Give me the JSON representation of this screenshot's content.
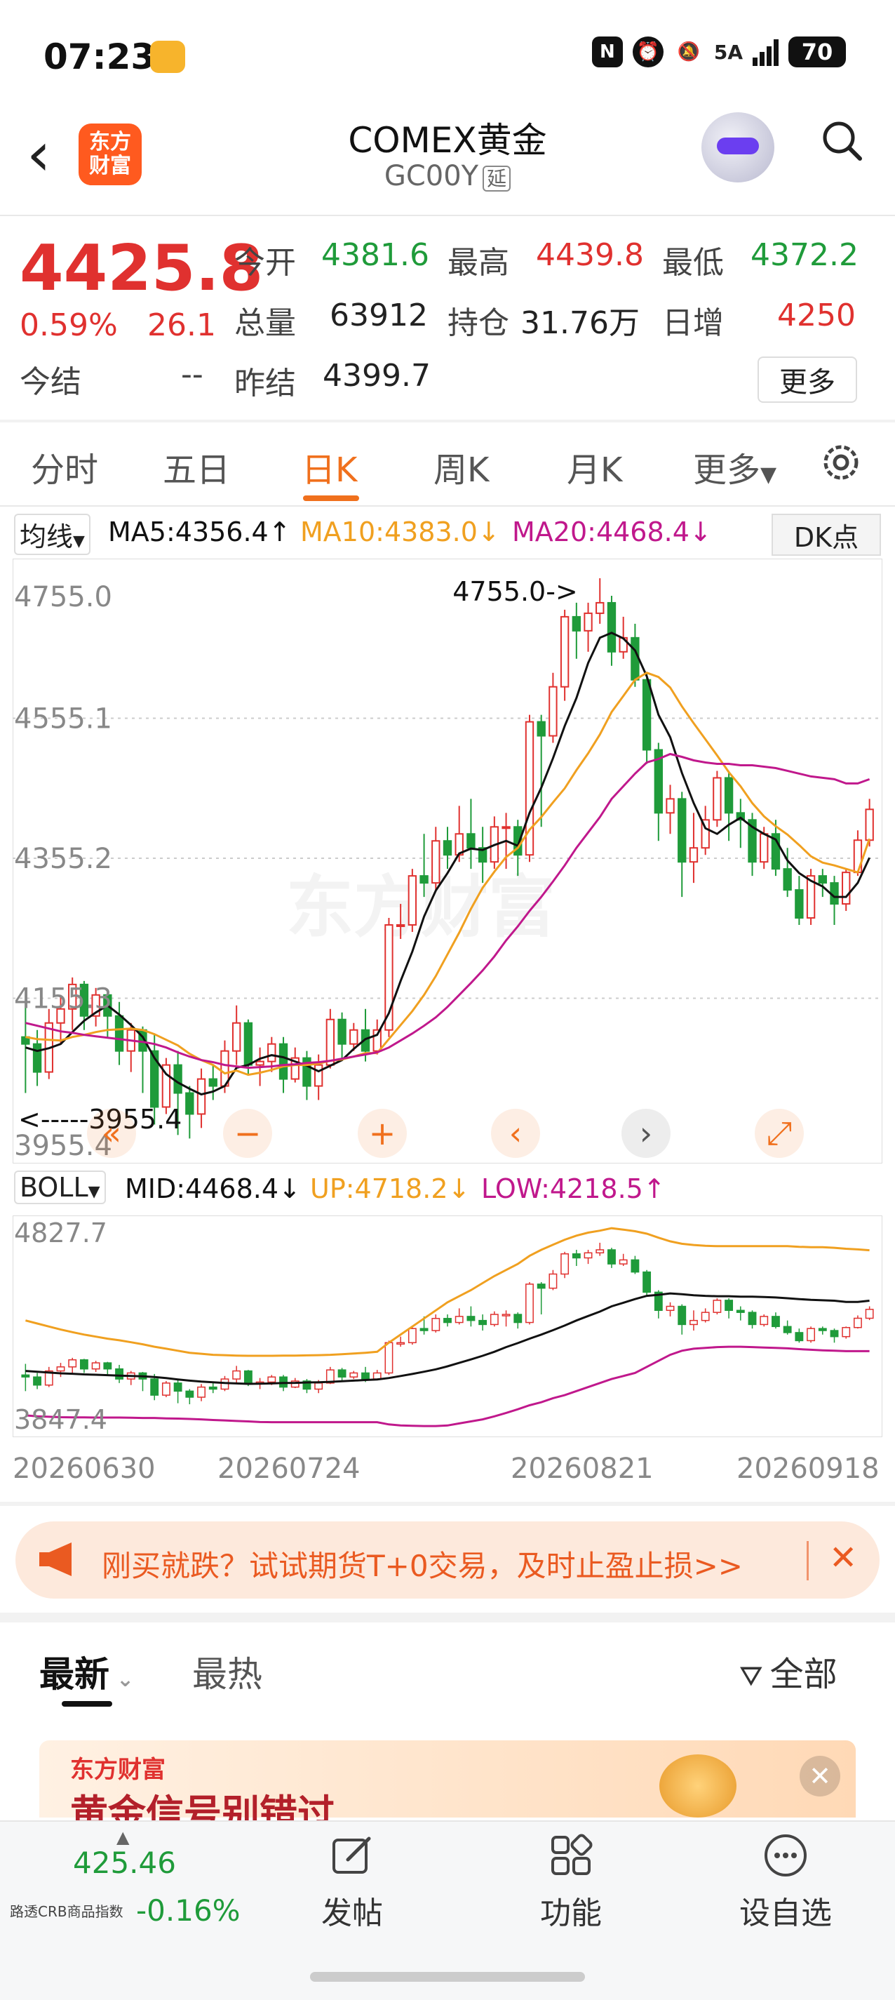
{
  "status": {
    "time": "07:23",
    "network": "5A",
    "battery": "70"
  },
  "header": {
    "title": "COMEX黄金",
    "code": "GC00Y",
    "delay_tag": "延",
    "logo_line1": "东方",
    "logo_line2": "财富"
  },
  "quote": {
    "price": "4425.8",
    "change_pct": "0.59%",
    "change": "26.1",
    "fields": [
      {
        "label": "今开",
        "value": "4381.6",
        "color": "green"
      },
      {
        "label": "最高",
        "value": "4439.8",
        "color": "red"
      },
      {
        "label": "最低",
        "value": "4372.2",
        "color": "green"
      },
      {
        "label": "总量",
        "value": "63912",
        "color": "dark"
      },
      {
        "label": "持仓",
        "value": "31.76万",
        "color": "dark"
      },
      {
        "label": "日增",
        "value": "4250",
        "color": "red"
      }
    ],
    "settle_label": "今结",
    "settle_value": "--",
    "prev_settle_label": "昨结",
    "prev_settle_value": "4399.7",
    "more_button": "更多"
  },
  "tabs": [
    "分时",
    "五日",
    "日K",
    "周K",
    "月K",
    "更多"
  ],
  "active_tab": "日K",
  "indicators": {
    "ma_select": "均线",
    "ma5": "MA5:4356.4↑",
    "ma10": "MA10:4383.0↓",
    "ma20": "MA20:4468.4↓",
    "dk_button": "DK点",
    "boll_select": "BOLL",
    "mid": "MID:4468.4↓",
    "up": "UP:4718.2↓",
    "low": "LOW:4218.5↑"
  },
  "colors": {
    "up": "#e0312f",
    "down": "#1f9b3a",
    "ma5": "#111111",
    "ma10": "#f0a020",
    "ma20": "#c0188c",
    "accent": "#f0701d"
  },
  "chart_data": [
    {
      "type": "candlestick",
      "title": "",
      "y_ticks": [
        "4755.0",
        "4555.1",
        "4355.2",
        "4155.3",
        "3955.4"
      ],
      "ylim": [
        3955.4,
        4755.0
      ],
      "annotations": {
        "high": "4755.0->",
        "low": "<-----3955.4"
      },
      "candles": [
        [
          4100,
          4090,
          4155,
          4020
        ],
        [
          4090,
          4050,
          4110,
          4030
        ],
        [
          4050,
          4120,
          4140,
          4040
        ],
        [
          4120,
          4140,
          4160,
          4090
        ],
        [
          4140,
          4175,
          4185,
          4110
        ],
        [
          4175,
          4130,
          4180,
          4110
        ],
        [
          4130,
          4160,
          4170,
          4115
        ],
        [
          4160,
          4130,
          4165,
          4100
        ],
        [
          4130,
          4080,
          4150,
          4060
        ],
        [
          4080,
          4110,
          4120,
          4050
        ],
        [
          4110,
          4080,
          4115,
          4020
        ],
        [
          4080,
          4000,
          4105,
          3975
        ],
        [
          4000,
          4060,
          4070,
          3990
        ],
        [
          4060,
          4020,
          4080,
          3960
        ],
        [
          4020,
          3990,
          4030,
          3955
        ],
        [
          3990,
          4040,
          4055,
          3970
        ],
        [
          4040,
          4030,
          4060,
          4010
        ],
        [
          4030,
          4080,
          4095,
          4020
        ],
        [
          4080,
          4120,
          4145,
          4060
        ],
        [
          4120,
          4060,
          4125,
          4045
        ],
        [
          4060,
          4065,
          4085,
          4030
        ],
        [
          4065,
          4090,
          4100,
          4050
        ],
        [
          4090,
          4040,
          4100,
          4020
        ],
        [
          4040,
          4070,
          4085,
          4035
        ],
        [
          4070,
          4030,
          4080,
          4010
        ],
        [
          4030,
          4060,
          4075,
          4010
        ],
        [
          4060,
          4125,
          4140,
          4055
        ],
        [
          4125,
          4090,
          4135,
          4070
        ],
        [
          4090,
          4110,
          4120,
          4080
        ],
        [
          4110,
          4080,
          4140,
          4065
        ],
        [
          4080,
          4110,
          4125,
          4075
        ],
        [
          4110,
          4260,
          4270,
          4100
        ],
        [
          4260,
          4260,
          4290,
          4240
        ],
        [
          4260,
          4330,
          4340,
          4250
        ],
        [
          4330,
          4320,
          4390,
          4300
        ],
        [
          4320,
          4380,
          4400,
          4310
        ],
        [
          4380,
          4360,
          4400,
          4340
        ],
        [
          4360,
          4390,
          4430,
          4350
        ],
        [
          4390,
          4370,
          4440,
          4340
        ],
        [
          4370,
          4350,
          4400,
          4320
        ],
        [
          4350,
          4400,
          4415,
          4340
        ],
        [
          4400,
          4400,
          4420,
          4340
        ],
        [
          4400,
          4360,
          4410,
          4330
        ],
        [
          4360,
          4550,
          4560,
          4350
        ],
        [
          4550,
          4530,
          4560,
          4400
        ],
        [
          4530,
          4600,
          4620,
          4520
        ],
        [
          4600,
          4700,
          4710,
          4580
        ],
        [
          4700,
          4680,
          4720,
          4640
        ],
        [
          4680,
          4705,
          4720,
          4650
        ],
        [
          4705,
          4720,
          4755,
          4690
        ],
        [
          4720,
          4650,
          4730,
          4630
        ],
        [
          4650,
          4670,
          4700,
          4640
        ],
        [
          4670,
          4610,
          4690,
          4600
        ],
        [
          4610,
          4510,
          4620,
          4490
        ],
        [
          4510,
          4420,
          4520,
          4380
        ],
        [
          4420,
          4440,
          4460,
          4390
        ],
        [
          4440,
          4350,
          4450,
          4300
        ],
        [
          4350,
          4370,
          4420,
          4320
        ],
        [
          4370,
          4410,
          4430,
          4360
        ],
        [
          4410,
          4470,
          4480,
          4400
        ],
        [
          4470,
          4420,
          4480,
          4380
        ],
        [
          4420,
          4410,
          4440,
          4370
        ],
        [
          4410,
          4350,
          4420,
          4330
        ],
        [
          4350,
          4390,
          4400,
          4340
        ],
        [
          4390,
          4340,
          4410,
          4330
        ],
        [
          4340,
          4310,
          4370,
          4300
        ],
        [
          4310,
          4270,
          4330,
          4260
        ],
        [
          4270,
          4330,
          4340,
          4260
        ],
        [
          4330,
          4320,
          4340,
          4300
        ],
        [
          4320,
          4290,
          4330,
          4260
        ],
        [
          4290,
          4335,
          4340,
          4280
        ],
        [
          4335,
          4381,
          4395,
          4330
        ],
        [
          4381,
          4425,
          4440,
          4372
        ]
      ],
      "ma5": [
        4085,
        4080,
        4084,
        4090,
        4107,
        4123,
        4135,
        4145,
        4132,
        4117,
        4100,
        4070,
        4047,
        4035,
        4026,
        4018,
        4022,
        4030,
        4056,
        4060,
        4069,
        4074,
        4071,
        4065,
        4059,
        4051,
        4059,
        4067,
        4083,
        4097,
        4103,
        4134,
        4180,
        4222,
        4272,
        4309,
        4334,
        4362,
        4369,
        4367,
        4374,
        4380,
        4373,
        4420,
        4456,
        4498,
        4544,
        4584,
        4634,
        4670,
        4677,
        4669,
        4652,
        4615,
        4560,
        4528,
        4477,
        4434,
        4398,
        4390,
        4403,
        4413,
        4400,
        4390,
        4382,
        4352,
        4334,
        4323,
        4315,
        4300,
        4300,
        4320,
        4356
      ],
      "ma10": [
        4100,
        4097,
        4096,
        4095,
        4100,
        4103,
        4107,
        4110,
        4111,
        4112,
        4110,
        4104,
        4096,
        4088,
        4076,
        4067,
        4060,
        4048,
        4052,
        4046,
        4049,
        4053,
        4058,
        4060,
        4060,
        4062,
        4066,
        4068,
        4072,
        4077,
        4077,
        4097,
        4117,
        4137,
        4160,
        4187,
        4218,
        4249,
        4283,
        4313,
        4336,
        4357,
        4370,
        4396,
        4414,
        4435,
        4455,
        4481,
        4505,
        4532,
        4564,
        4587,
        4610,
        4620,
        4614,
        4599,
        4572,
        4548,
        4525,
        4502,
        4478,
        4458,
        4434,
        4415,
        4401,
        4389,
        4374,
        4358,
        4349,
        4345,
        4340,
        4335,
        4383
      ],
      "ma20": [
        4120,
        4116,
        4112,
        4108,
        4106,
        4103,
        4101,
        4099,
        4097,
        4095,
        4093,
        4090,
        4085,
        4078,
        4072,
        4067,
        4064,
        4060,
        4058,
        4056,
        4057,
        4058,
        4060,
        4061,
        4063,
        4064,
        4066,
        4069,
        4072,
        4075,
        4078,
        4085,
        4095,
        4105,
        4116,
        4128,
        4143,
        4160,
        4177,
        4195,
        4215,
        4238,
        4258,
        4280,
        4300,
        4322,
        4345,
        4370,
        4392,
        4414,
        4440,
        4458,
        4476,
        4492,
        4497,
        4504,
        4500,
        4495,
        4492,
        4490,
        4490,
        4488,
        4488,
        4486,
        4484,
        4480,
        4476,
        4472,
        4470,
        4468,
        4462,
        4462,
        4468
      ]
    },
    {
      "type": "boll",
      "title": "",
      "y_ticks": [
        "4827.7",
        "3847.4"
      ],
      "ylim": [
        3847.4,
        4827.7
      ],
      "mid": [
        4120,
        4116,
        4112,
        4108,
        4106,
        4103,
        4101,
        4099,
        4097,
        4095,
        4093,
        4090,
        4085,
        4078,
        4072,
        4067,
        4064,
        4060,
        4058,
        4056,
        4057,
        4058,
        4060,
        4061,
        4063,
        4064,
        4066,
        4069,
        4072,
        4075,
        4078,
        4085,
        4095,
        4105,
        4116,
        4128,
        4143,
        4160,
        4177,
        4195,
        4215,
        4238,
        4258,
        4280,
        4300,
        4322,
        4345,
        4370,
        4392,
        4414,
        4440,
        4458,
        4476,
        4492,
        4497,
        4504,
        4500,
        4495,
        4492,
        4490,
        4490,
        4488,
        4488,
        4486,
        4484,
        4480,
        4476,
        4472,
        4470,
        4468,
        4462,
        4462,
        4468
      ],
      "up": [
        4370,
        4355,
        4340,
        4325,
        4312,
        4300,
        4290,
        4280,
        4272,
        4262,
        4252,
        4240,
        4230,
        4220,
        4210,
        4205,
        4200,
        4198,
        4196,
        4195,
        4195,
        4195,
        4196,
        4196,
        4197,
        4198,
        4200,
        4203,
        4206,
        4210,
        4215,
        4260,
        4300,
        4340,
        4380,
        4420,
        4460,
        4490,
        4520,
        4555,
        4590,
        4620,
        4650,
        4690,
        4720,
        4745,
        4770,
        4790,
        4805,
        4815,
        4827,
        4820,
        4812,
        4800,
        4780,
        4762,
        4750,
        4744,
        4740,
        4738,
        4738,
        4738,
        4738,
        4738,
        4738,
        4738,
        4735,
        4733,
        4733,
        4730,
        4725,
        4722,
        4718
      ],
      "low": [
        3900,
        3895,
        3893,
        3891,
        3890,
        3890,
        3889,
        3889,
        3889,
        3888,
        3887,
        3887,
        3885,
        3884,
        3882,
        3880,
        3877,
        3875,
        3872,
        3870,
        3867,
        3866,
        3866,
        3866,
        3866,
        3866,
        3866,
        3866,
        3866,
        3866,
        3866,
        3855,
        3850,
        3848,
        3847,
        3847,
        3850,
        3860,
        3870,
        3880,
        3895,
        3912,
        3930,
        3950,
        3965,
        3985,
        4000,
        4020,
        4040,
        4060,
        4080,
        4095,
        4110,
        4140,
        4170,
        4200,
        4220,
        4230,
        4234,
        4238,
        4240,
        4240,
        4238,
        4236,
        4234,
        4232,
        4228,
        4225,
        4222,
        4220,
        4218,
        4218,
        4218
      ]
    }
  ],
  "dates": [
    "20260630",
    "20260724",
    "20260821",
    "20260918"
  ],
  "chart_controls": [
    "«",
    "−",
    "+",
    "‹",
    "›",
    "⤢"
  ],
  "watermark": "东方财富",
  "banner": {
    "text": "刚买就跌？试试期货T+0交易，及时止盈止损>>",
    "close": "✕"
  },
  "news_tabs": {
    "latest": "最新",
    "hot": "最热",
    "filter": "全部"
  },
  "promo": {
    "brand": "东方财富",
    "title": "黄金信号别错过"
  },
  "bottom_nav": {
    "index_value": "425.46",
    "index_name": "路透CRB商品指数",
    "index_change": "-0.16%",
    "items": [
      "发帖",
      "功能",
      "设自选"
    ]
  }
}
